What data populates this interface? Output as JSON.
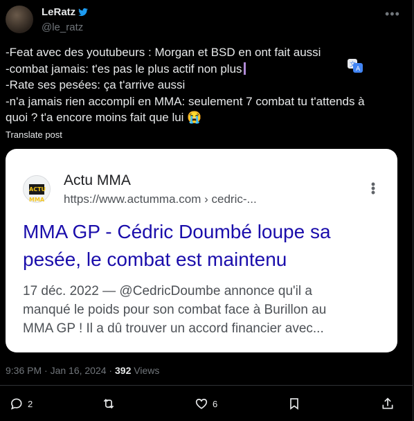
{
  "author": {
    "name": "LeRatz",
    "handle": "@le_ratz"
  },
  "post": {
    "lines": [
      "-Feat avec des youtubeurs : Morgan et BSD en ont fait aussi",
      "-combat jamais: t'es pas le plus actif non plus",
      "-Rate ses pesées: ça t'arrive aussi",
      "-n'a jamais rien accompli en MMA: seulement 7 combat tu t'attends à",
      "quoi ? t'a encore moins fait que lui 😭"
    ],
    "translate_label": "Translate post"
  },
  "card": {
    "logo_text": "ACTU MMA",
    "site_name": "Actu MMA",
    "url": "https://www.actumma.com › cedric-...",
    "headline": "MMA GP - Cédric Doumbé loupe sa pesée, le combat est maintenu",
    "snippet_lines": [
      "17 déc. 2022 — @CedricDoumbe annonce qu'il a",
      "manqué le poids pour son combat face à Burillon au",
      "MMA GP ! Il a dû trouver un accord financier avec..."
    ]
  },
  "meta": {
    "timestamp": "9:36 PM · Jan 16, 2024",
    "separator": " · ",
    "views_count": "392",
    "views_label": " Views"
  },
  "actions": {
    "replies": "2",
    "likes": "6"
  },
  "colors": {
    "background": "#000000",
    "text": "#e7e9ea",
    "muted": "#71767b",
    "verified": "#1d9bf0",
    "link": "#1a0dab"
  }
}
